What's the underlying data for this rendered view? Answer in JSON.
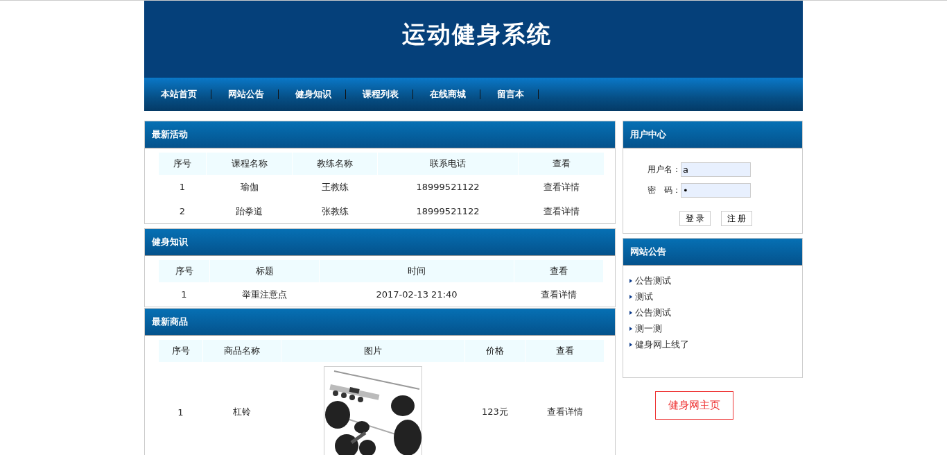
{
  "site_title": "运动健身系统",
  "nav": [
    "本站首页",
    "网站公告",
    "健身知识",
    "课程列表",
    "在线商城",
    "留言本"
  ],
  "sections": [
    {
      "kind": "courses",
      "title": "最新活动",
      "columns": [
        {
          "label": "序号",
          "kind": "text"
        },
        {
          "label": "课程名称",
          "kind": "text"
        },
        {
          "label": "教练名称",
          "kind": "text"
        },
        {
          "label": "联系电话",
          "kind": "text"
        },
        {
          "label": "查看",
          "kind": "link"
        }
      ],
      "rows": [
        [
          "1",
          "瑜伽",
          "王教练",
          "18999521122",
          "查看详情"
        ],
        [
          "2",
          "跆拳道",
          "张教练",
          "18999521122",
          "查看详情"
        ]
      ]
    },
    {
      "kind": "knowledge",
      "title": "健身知识",
      "columns": [
        {
          "label": "序号",
          "kind": "text"
        },
        {
          "label": "标题",
          "kind": "text"
        },
        {
          "label": "时间",
          "kind": "text"
        },
        {
          "label": "查看",
          "kind": "link"
        }
      ],
      "rows": [
        [
          "1",
          "举重注意点",
          "2017-02-13 21:40",
          "查看详情"
        ]
      ]
    },
    {
      "kind": "products",
      "title": "最新商品",
      "columns": [
        {
          "label": "序号",
          "kind": "text"
        },
        {
          "label": "商品名称",
          "kind": "text"
        },
        {
          "label": "图片",
          "kind": "image"
        },
        {
          "label": "价格",
          "kind": "text"
        },
        {
          "label": "查看",
          "kind": "link"
        }
      ],
      "rows": [
        [
          "1",
          "杠铃",
          "",
          "123元",
          "查看详情"
        ]
      ]
    }
  ],
  "user_center": {
    "title": "用户中心",
    "fields": [
      {
        "label": "用户名：",
        "value": "a"
      },
      {
        "label": "密　码：",
        "value": "•"
      }
    ],
    "buttons": [
      "登 录",
      "注 册"
    ]
  },
  "notices": {
    "title": "网站公告",
    "items": [
      "公告测试",
      "测试",
      "公告测试",
      "测一测",
      "健身网上线了"
    ]
  },
  "home_link": "健身网主页"
}
